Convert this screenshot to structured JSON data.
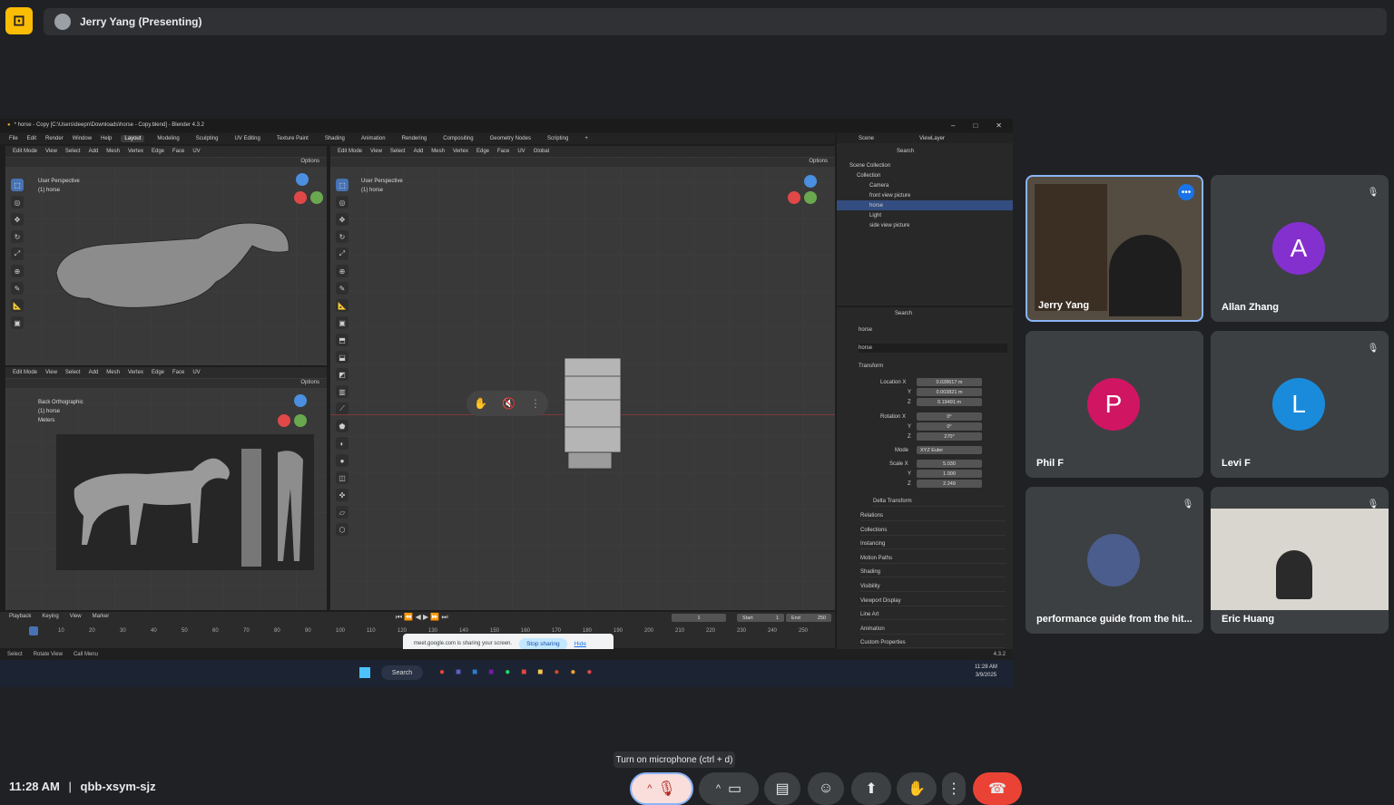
{
  "meet": {
    "presenter_label": "Jerry Yang (Presenting)",
    "meeting_code": "qbb-xsym-sjz",
    "time": "11:28 AM",
    "separator": "|",
    "tooltip": "Turn on microphone (ctrl + d)",
    "participants": [
      {
        "name": "Jerry Yang",
        "initial": "",
        "color": "#8ab4f8"
      },
      {
        "name": "Allan Zhang",
        "initial": "A",
        "color": "#8430ce"
      },
      {
        "name": "Phil F",
        "initial": "P",
        "color": "#d01563"
      },
      {
        "name": "Levi F",
        "initial": "L",
        "color": "#1a8bdb"
      },
      {
        "name": "performance guide from the hit...",
        "initial": "",
        "color": "#3c4043"
      },
      {
        "name": "Eric Huang",
        "initial": "",
        "color": "#3c4043"
      }
    ],
    "share_toast": {
      "text": "meet.google.com is sharing your screen.",
      "stop": "Stop sharing",
      "hide": "Hide"
    }
  },
  "blender": {
    "title": "* horse - Copy [C:\\Users\\deepn\\Downloads\\horse - Copy.blend] - Blender 4.3.2",
    "menus": [
      "File",
      "Edit",
      "Render",
      "Window",
      "Help"
    ],
    "workspaces": [
      "Layout",
      "Modeling",
      "Sculpting",
      "UV Editing",
      "Texture Paint",
      "Shading",
      "Animation",
      "Rendering",
      "Compositing",
      "Geometry Nodes",
      "Scripting",
      "+"
    ],
    "active_workspace": "Layout",
    "viewport_header": [
      "Edit Mode",
      "View",
      "Select",
      "Add",
      "Mesh",
      "Vertex",
      "Edge",
      "Face",
      "UV"
    ],
    "main_header_extra": "Global",
    "options": "Options",
    "vp1_label": [
      "User Perspective",
      "(1) horse"
    ],
    "vp2_label": [
      "Back Orthographic",
      "(1) horse",
      "Meters"
    ],
    "vp3_label": [
      "User Perspective",
      "(1) horse"
    ],
    "outliner": {
      "scene": "Scene",
      "view_layer": "ViewLayer",
      "search": "Search",
      "items": [
        "Scene Collection",
        "Collection",
        "Camera",
        "front view picture",
        "horse",
        "Light",
        "side view picture"
      ]
    },
    "properties": {
      "search": "Search",
      "object_name": "horse",
      "data_name": "horse",
      "transform": "Transform",
      "location_label": "Location X",
      "location": [
        "0.028617 m",
        "0.003821 m",
        "0.19491 m"
      ],
      "rotation_label": "Rotation X",
      "rotation": [
        "0°",
        "0°",
        "270°"
      ],
      "mode_label": "Mode",
      "mode": "XYZ Euler",
      "scale_label": "Scale X",
      "scale": [
        "5.030",
        "1.000",
        "2.249"
      ],
      "y": "Y",
      "z": "Z",
      "sections": [
        "Delta Transform",
        "Relations",
        "Collections",
        "Instancing",
        "Motion Paths",
        "Shading",
        "Visibility",
        "Viewport Display",
        "Line Art",
        "Animation",
        "Custom Properties"
      ]
    },
    "timeline": {
      "menus": [
        "Playback",
        "Keying",
        "View",
        "Marker"
      ],
      "current": "1",
      "start_label": "Start",
      "start": "1",
      "end_label": "End",
      "end": "250",
      "ticks": [
        "10",
        "20",
        "30",
        "40",
        "50",
        "60",
        "70",
        "80",
        "90",
        "100",
        "110",
        "120",
        "130",
        "140",
        "150",
        "160",
        "170",
        "180",
        "190",
        "200",
        "210",
        "220",
        "230",
        "240",
        "250"
      ]
    },
    "status": [
      "Select",
      "Rotate View",
      "Call Menu"
    ],
    "version": "4.3.2"
  },
  "taskbar": {
    "search": "Search",
    "time": "11:28 AM",
    "date": "3/9/2025"
  }
}
